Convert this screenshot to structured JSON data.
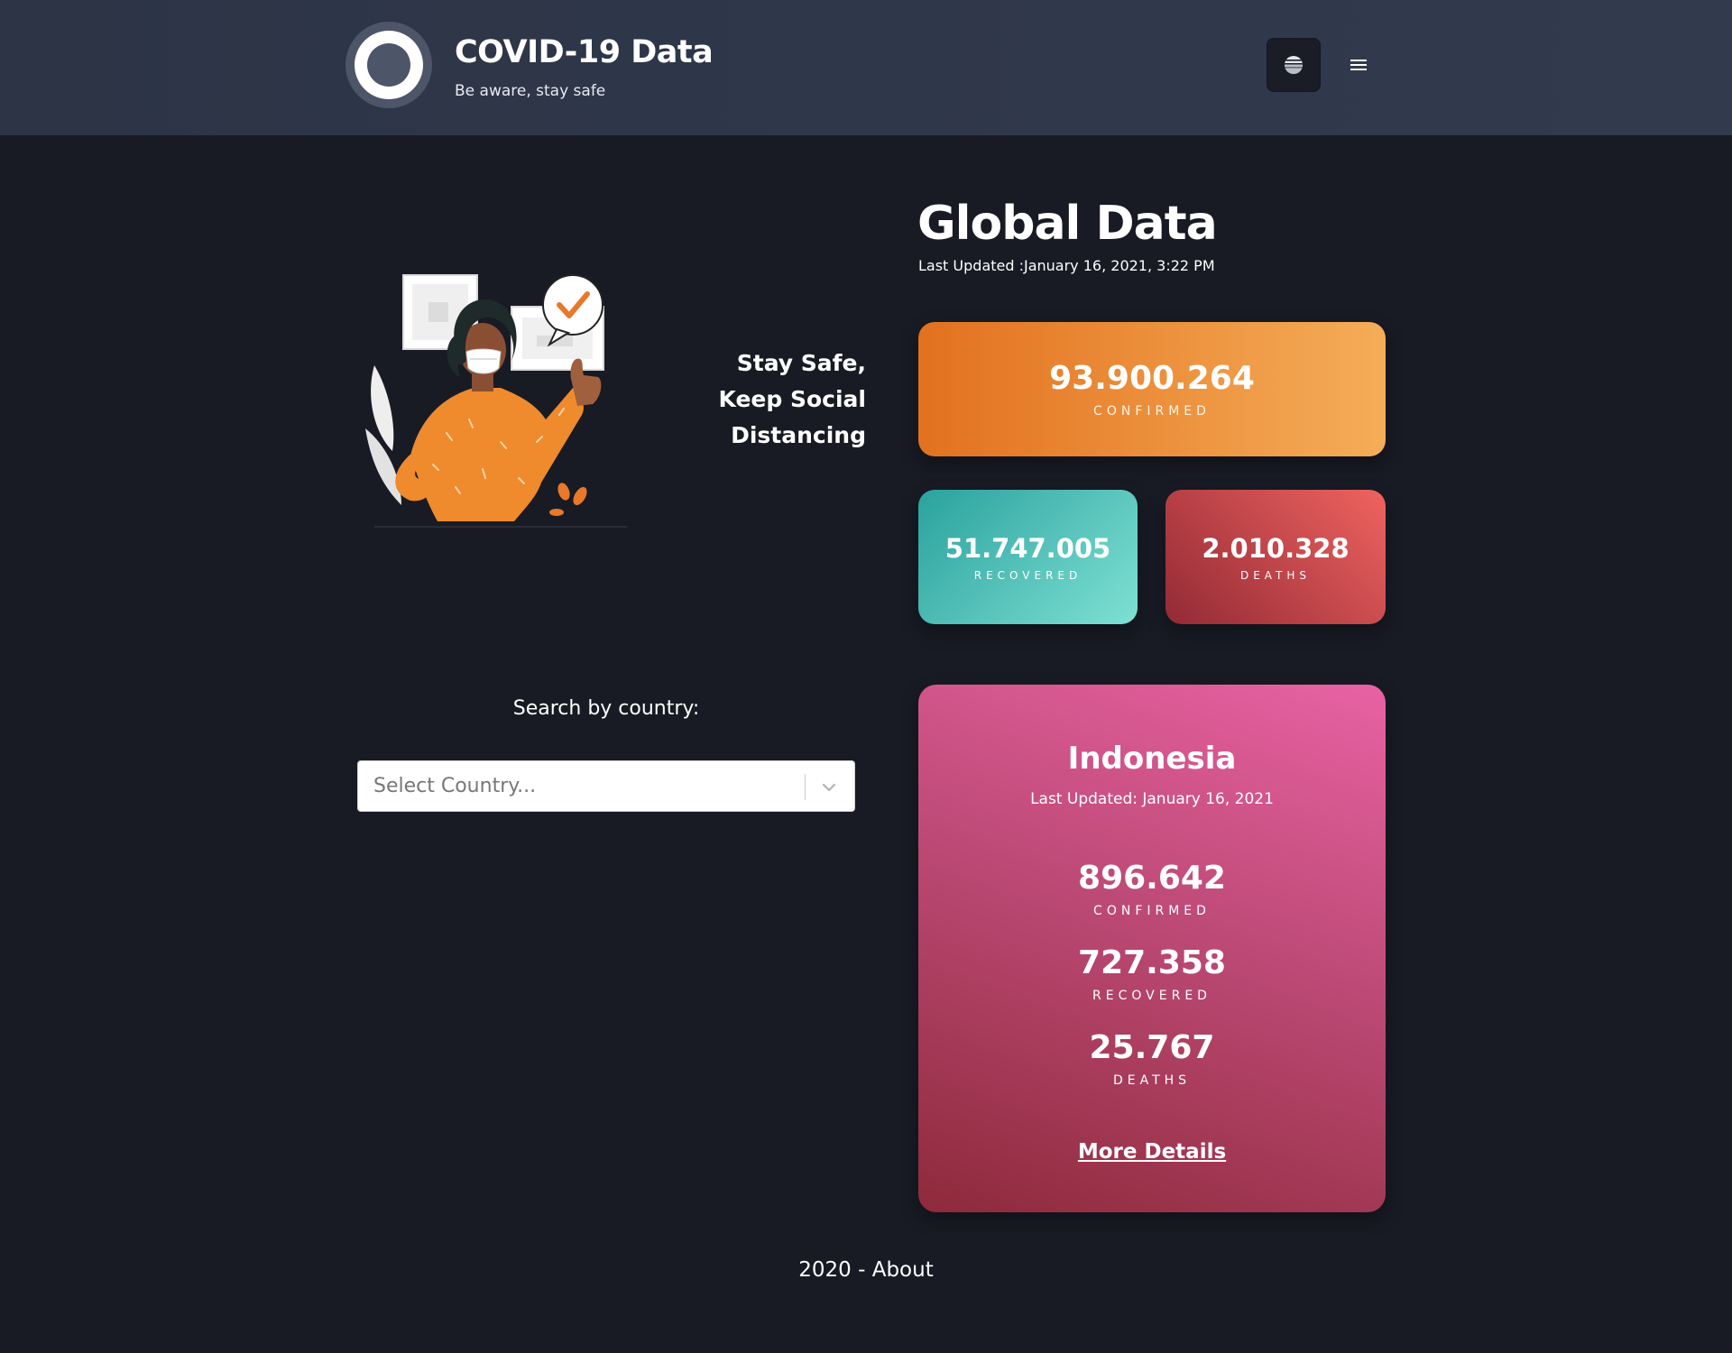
{
  "header": {
    "title": "COVID-19 Data",
    "subtitle": "Be aware, stay safe",
    "icons": {
      "logo": "logo-icon",
      "theme": "theme-toggle-icon",
      "menu": "hamburger-menu-icon"
    }
  },
  "hero": {
    "tagline": [
      "Stay Safe,",
      "Keep Social",
      "Distancing"
    ],
    "illustration": "woman-wearing-mask-illustration"
  },
  "global": {
    "title": "Global Data",
    "last_updated": "Last Updated :January 16, 2021, 3:22 PM",
    "confirmed": {
      "value": "93.900.264",
      "label": "CONFIRMED"
    },
    "recovered": {
      "value": "51.747.005",
      "label": "RECOVERED"
    },
    "deaths": {
      "value": "2.010.328",
      "label": "DEATHS"
    }
  },
  "search": {
    "label": "Search by country:",
    "placeholder": "Select Country..."
  },
  "country": {
    "name": "Indonesia",
    "last_updated": "Last Updated: January 16, 2021",
    "confirmed": {
      "value": "896.642",
      "label": "CONFIRMED"
    },
    "recovered": {
      "value": "727.358",
      "label": "RECOVERED"
    },
    "deaths": {
      "value": "25.767",
      "label": "DEATHS"
    },
    "more_details": "More Details"
  },
  "footer": {
    "year": "2020",
    "separator": " - ",
    "about": "About"
  },
  "colors": {
    "background": "#181b24",
    "header": "#2c3446",
    "confirmed_accent": "#e2711f",
    "recovered_accent": "#2aa29d",
    "deaths_accent": "#932a35",
    "country_card_accent": "#e862a3"
  }
}
